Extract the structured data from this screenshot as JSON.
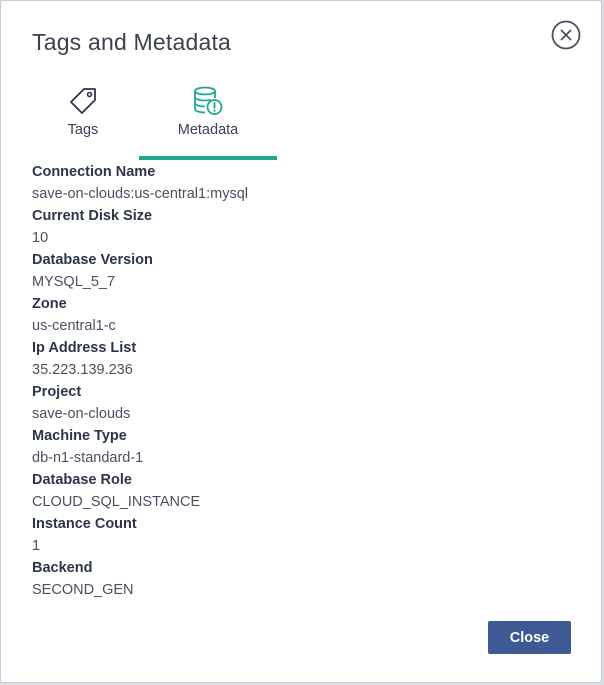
{
  "dialog": {
    "title": "Tags and Metadata",
    "close_icon": "close-circle-icon"
  },
  "tabs": [
    {
      "label": "Tags",
      "icon": "tag-icon",
      "active": false
    },
    {
      "label": "Metadata",
      "icon": "database-alert-icon",
      "active": true
    }
  ],
  "metadata": [
    {
      "label": "Connection Name",
      "value": "save-on-clouds:us-central1:mysql"
    },
    {
      "label": "Current Disk Size",
      "value": "10"
    },
    {
      "label": "Database Version",
      "value": "MYSQL_5_7"
    },
    {
      "label": "Zone",
      "value": "us-central1-c"
    },
    {
      "label": "Ip Address List",
      "value": "35.223.139.236"
    },
    {
      "label": "Project",
      "value": "save-on-clouds"
    },
    {
      "label": "Machine Type",
      "value": "db-n1-standard-1"
    },
    {
      "label": "Database Role",
      "value": "CLOUD_SQL_INSTANCE"
    },
    {
      "label": "Instance Count",
      "value": "1"
    },
    {
      "label": "Backend",
      "value": "SECOND_GEN"
    }
  ],
  "footer": {
    "close_label": "Close"
  },
  "colors": {
    "accent": "#1ea891",
    "primary_button": "#3e5a95",
    "title_text": "#3b4151"
  }
}
